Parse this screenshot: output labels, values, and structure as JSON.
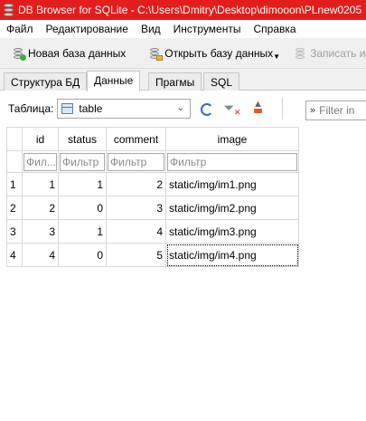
{
  "window": {
    "title": "DB Browser for SQLite - C:\\Users\\Dmitry\\Desktop\\dimooon\\PLnew0205"
  },
  "menu": [
    "Файл",
    "Редактирование",
    "Вид",
    "Инструменты",
    "Справка"
  ],
  "toolbar": {
    "new_db": "Новая база данных",
    "open_db": "Открыть базу данных",
    "write_changes": "Записать изме"
  },
  "tabs": [
    "Структура БД",
    "Данные",
    "Прагмы",
    "SQL"
  ],
  "active_tab": "Данные",
  "filterbar": {
    "table_label": "Таблица:",
    "table_selected": "table",
    "filter_placeholder": "Filter in",
    "chevron": "»"
  },
  "grid": {
    "columns": [
      "id",
      "status",
      "comment",
      "image"
    ],
    "filter_placeholders": [
      "Фил...",
      "Фильтр",
      "Фильтр",
      "Фильтр"
    ],
    "rows": [
      {
        "row": "1",
        "id": "1",
        "status": "1",
        "comment": "2",
        "image": "static/img/im1.png"
      },
      {
        "row": "2",
        "id": "2",
        "status": "0",
        "comment": "3",
        "image": "static/img/im2.png"
      },
      {
        "row": "3",
        "id": "3",
        "status": "1",
        "comment": "4",
        "image": "static/img/im3.png"
      },
      {
        "row": "4",
        "id": "4",
        "status": "0",
        "comment": "5",
        "image": "static/img/im4.png"
      }
    ]
  },
  "colors": {
    "titlebar": "#e31c1c",
    "menubar": "#ffffff",
    "toolbar": "#f0f0f0"
  }
}
